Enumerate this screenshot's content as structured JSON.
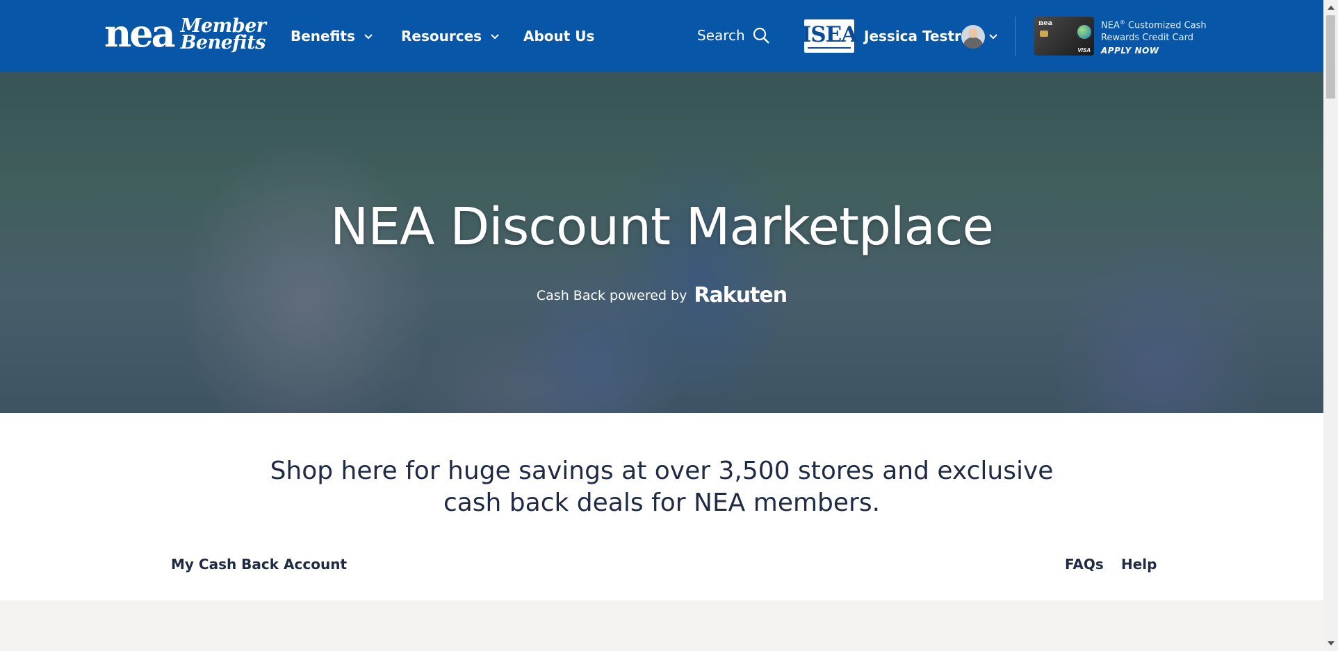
{
  "header": {
    "logo": {
      "nea": "nea",
      "member": "Member",
      "benefits": "Benefits"
    },
    "nav": [
      {
        "label": "Benefits",
        "has_dropdown": true
      },
      {
        "label": "Resources",
        "has_dropdown": true
      },
      {
        "label": "About Us",
        "has_dropdown": false
      }
    ],
    "search_label": "Search",
    "affiliate_logo_text": "ISEA",
    "user_name": "Jessica Testr'S",
    "card_promo": {
      "brand": "NEA",
      "line1_rest": " Customized Cash",
      "line2": "Rewards Credit Card",
      "cta": "APPLY NOW",
      "card_brand": "nea",
      "card_network": "VISA"
    }
  },
  "hero": {
    "title": "NEA Discount Marketplace",
    "subtitle": "Cash Back powered by",
    "partner": "Rakuten"
  },
  "tagline": "Shop here for huge savings at over 3,500 stores and exclusive cash back deals for NEA members.",
  "subnav": {
    "account": "My Cash Back Account",
    "faqs": "FAQs",
    "help": "Help"
  },
  "colors": {
    "header_bg": "#0756a8",
    "text_dark": "#1f2a44",
    "band_bg": "#f4f3f1"
  },
  "icons": [
    "search-icon",
    "chevron-down-icon",
    "avatar"
  ]
}
